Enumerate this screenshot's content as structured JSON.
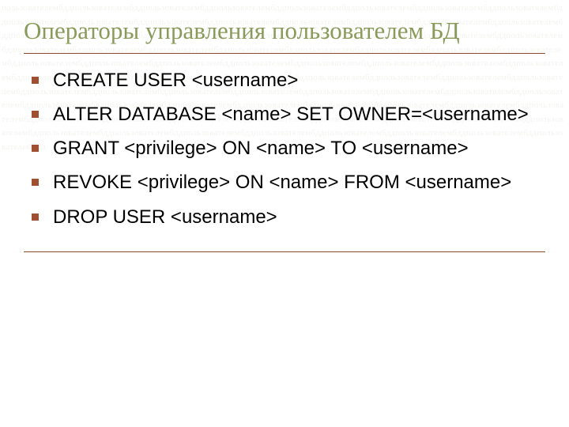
{
  "title": "Операторы управления пользователем БД",
  "items": [
    "CREATE USER <username>",
    "ALTER DATABASE <name> SET OWNER=<username>",
    "GRANT <privilege> ON <name> TO <username>",
    "REVOKE <privilege> ON <name> FROM <username>",
    "DROP USER <username>"
  ],
  "watermark_text": "пользователембддпользователембддпользователембддпользователембддпользователембддпользователембддпользователембддпользователембддпользователембддпользователембддпользователембддпользователембддпользователембддпользователембддпользователембддпользователембддпользователембддпользователембддпользователембддпользователембддпользователембддпользователембддпользователембддпользователембддпользователембддпользователембддпользователембддпользователембддпользователембддпользователембддпользователембддпользователембддпользователембддпользователембддпользователембддпользователембддпользователембддпользователембддпользователембддпользователембддпользователембддпользователембддпользователембддпользователембддпользователембддпользователембддпользователембддпользователембддпользователембддпользователембддпользователембддпользователембддпользователембддпользователембддпользователембддпользователембддпользователембддпользователембддпользователембддпользователембддпользователембддпользователембддпользователембддпользователембддпользователембддпользователембддпользователембддпользователембддпользователембддпользователембддпользователембддпользователембддпользователембддпользователембддпользователембддпользователембддпользователембддпользователембддпользователембддпользователембдд"
}
